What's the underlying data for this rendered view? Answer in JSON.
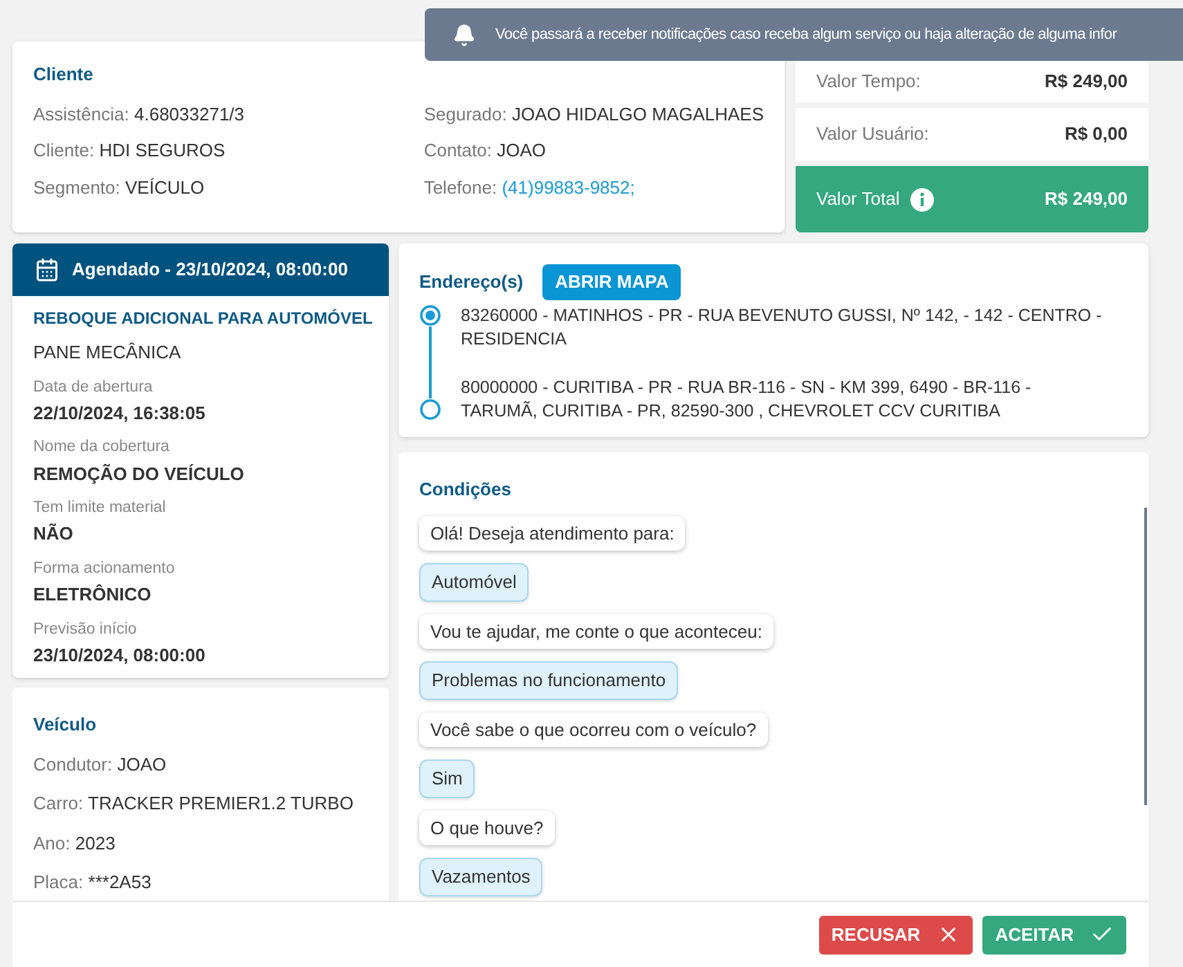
{
  "toast": {
    "text": "Você passará a receber notificações caso receba algum serviço ou haja alteração de alguma infor"
  },
  "client": {
    "title": "Cliente",
    "left_fields": [
      {
        "label": "Assistência:",
        "value": "4.68033271/3",
        "kind": "text"
      },
      {
        "label": "Cliente:",
        "value": "HDI SEGUROS",
        "kind": "text"
      },
      {
        "label": "Segmento:",
        "value": "VEÍCULO",
        "kind": "text"
      }
    ],
    "right_fields": [
      {
        "label": "Segurado:",
        "value": "JOAO HIDALGO MAGALHAES",
        "kind": "text"
      },
      {
        "label": "Contato:",
        "value": "JOAO",
        "kind": "text"
      },
      {
        "label": "Telefone:",
        "value": "(41)99883-9852;",
        "kind": "link"
      }
    ]
  },
  "prices": [
    {
      "label": "Valor Tempo:",
      "value": "R$ 249,00",
      "kind": "row"
    },
    {
      "label": "Valor Usuário:",
      "value": "R$ 0,00",
      "kind": "row"
    },
    {
      "label": "Valor Total",
      "value": "R$ 249,00",
      "kind": "total"
    }
  ],
  "schedule": {
    "header": "Agendado - 23/10/2024, 08:00:00",
    "service": "REBOQUE ADICIONAL PARA AUTOMÓVEL",
    "problem": "PANE MECÂNICA",
    "details": [
      {
        "label": "Data de abertura",
        "value": "22/10/2024, 16:38:05"
      },
      {
        "label": "Nome da cobertura",
        "value": "REMOÇÃO DO VEÍCULO"
      },
      {
        "label": "Tem limite material",
        "value": "NÃO"
      },
      {
        "label": "Forma acionamento",
        "value": "ELETRÔNICO"
      },
      {
        "label": "Previsão início",
        "value": "23/10/2024, 08:00:00"
      }
    ]
  },
  "vehicle": {
    "title": "Veículo",
    "fields": [
      {
        "label": "Condutor:",
        "value": "JOAO"
      },
      {
        "label": "Carro:",
        "value": "TRACKER PREMIER1.2 TURBO"
      },
      {
        "label": "Ano:",
        "value": "2023"
      },
      {
        "label": "Placa:",
        "value": "***2A53"
      }
    ]
  },
  "addresses": {
    "title": "Endereço(s)",
    "button": "ABRIR MAPA",
    "items": [
      {
        "text": "83260000 - MATINHOS - PR - RUA BEVENUTO GUSSI, Nº 142, - 142 - CENTRO - RESIDENCIA",
        "kind": "origin"
      },
      {
        "text": "80000000 - CURITIBA - PR - RUA BR-116 - SN - KM 399, 6490 - BR-116 - TARUMÃ, CURITIBA - PR, 82590-300 , CHEVROLET CCV CURITIBA",
        "kind": "destination"
      }
    ]
  },
  "conditions": {
    "title": "Condições",
    "messages": [
      {
        "kind": "question",
        "text": "Olá! Deseja atendimento para:"
      },
      {
        "kind": "answer",
        "text": "Automóvel"
      },
      {
        "kind": "question",
        "text": "Vou te ajudar, me conte o que aconteceu:"
      },
      {
        "kind": "answer",
        "text": "Problemas no funcionamento"
      },
      {
        "kind": "question",
        "text": "Você sabe o que ocorreu com o veículo?"
      },
      {
        "kind": "answer",
        "text": "Sim"
      },
      {
        "kind": "question",
        "text": "O que houve?"
      },
      {
        "kind": "answer",
        "text": "Vazamentos"
      }
    ]
  },
  "actions": [
    {
      "label": "RECUSAR",
      "kind": "reject"
    },
    {
      "label": "ACEITAR",
      "kind": "accept"
    }
  ]
}
